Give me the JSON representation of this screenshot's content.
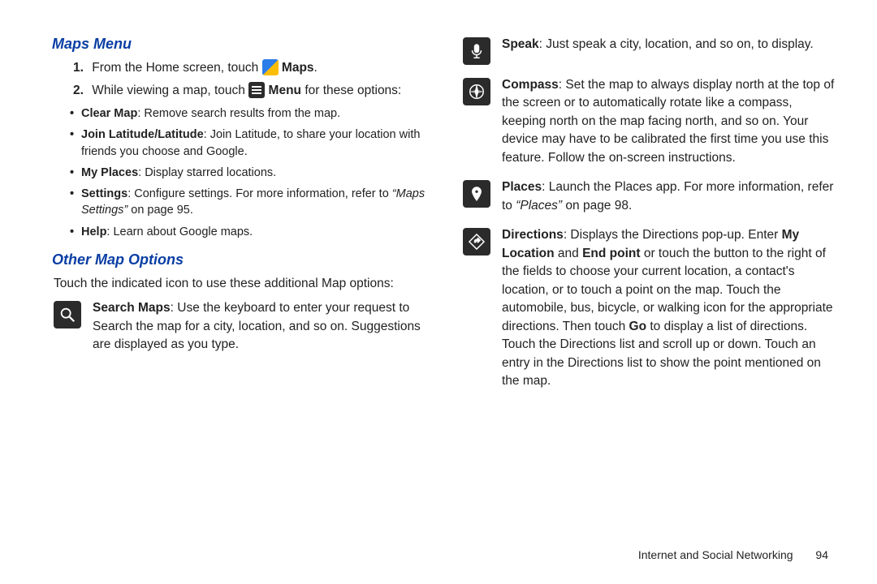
{
  "left": {
    "heading1": "Maps Menu",
    "step1_prefix": "From the Home screen, touch ",
    "step1_bold": "Maps",
    "step2_prefix": "While viewing a map, touch ",
    "step2_bold": "Menu",
    "step2_suffix": " for these options:",
    "bullets": [
      {
        "b": "Clear Map",
        "t": ": Remove search results from the map."
      },
      {
        "b": "Join Latitude/Latitude",
        "t": ": Join Latitude, to share your location with friends you choose and Google."
      },
      {
        "b": "My Places",
        "t": ": Display starred locations."
      },
      {
        "b": "Settings",
        "t": ": Configure settings. For more information, refer to ",
        "ital": "“Maps Settings”",
        "after": " on page 95."
      },
      {
        "b": "Help",
        "t": ": Learn about Google maps."
      }
    ],
    "heading2": "Other Map Options",
    "intro": "Touch the indicated icon to use these additional Map options:",
    "search": {
      "b": "Search Maps",
      "t": ": Use the keyboard to enter your request to Search the map for a city, location, and so on. Suggestions are displayed as you type."
    }
  },
  "right": {
    "speak": {
      "b": "Speak",
      "t": ": Just speak a city, location, and so on, to display."
    },
    "compass": {
      "b": "Compass",
      "t": ": Set the map to always display north at the top of the screen or to automatically rotate like a compass, keeping north on the map facing north, and so on. Your device may have to be calibrated the first time you use this feature. Follow the on-screen instructions."
    },
    "places": {
      "b": "Places",
      "t1": ": Launch the Places app. For more information, refer to ",
      "ital": "“Places”",
      "t2": " on page 98."
    },
    "directions": {
      "b": "Directions",
      "pre": ": Displays the Directions pop-up. Enter ",
      "b2": "My Location",
      "and": " and ",
      "b3": "End point",
      "mid": " or touch the button to the right of the fields to choose your current location, a contact's location, or to touch a point on the map. Touch the automobile, bus, bicycle, or walking icon for the appropriate directions. Then touch ",
      "b4": "Go",
      "post": " to display a list of directions. Touch the Directions list and scroll up or down. Touch an entry in the Directions list to show the point mentioned on the map."
    }
  },
  "footer": {
    "section": "Internet and Social Networking",
    "page": "94"
  }
}
